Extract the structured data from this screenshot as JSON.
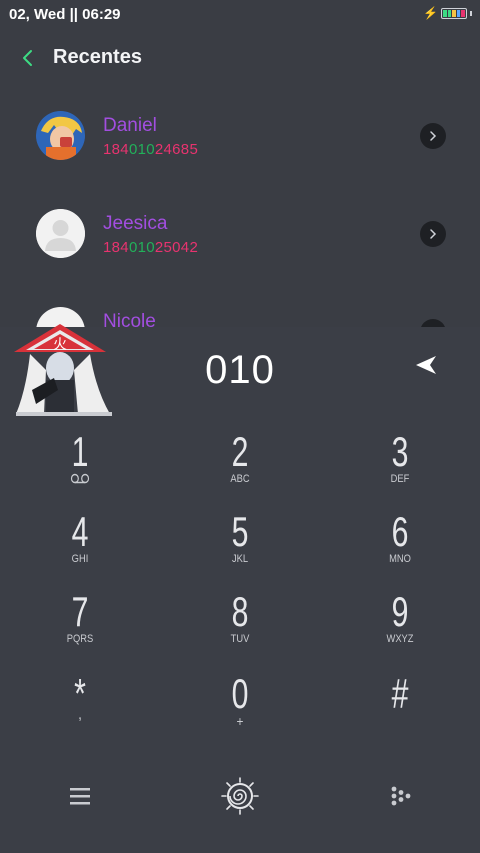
{
  "status": {
    "time": "02, Wed || 06:29"
  },
  "header": {
    "title": "Recentes"
  },
  "contacts": [
    {
      "name": "Daniel",
      "number_pre": "184",
      "number_hl": "010",
      "number_post": "24685"
    },
    {
      "name": "Jeesica",
      "number_pre": "184",
      "number_hl": "010",
      "number_post": "25042"
    },
    {
      "name": "Nicole"
    }
  ],
  "dialer": {
    "input": "010",
    "keys": [
      {
        "digit": "1",
        "sub": ""
      },
      {
        "digit": "2",
        "sub": "ABC"
      },
      {
        "digit": "3",
        "sub": "DEF"
      },
      {
        "digit": "4",
        "sub": "GHI"
      },
      {
        "digit": "5",
        "sub": "JKL"
      },
      {
        "digit": "6",
        "sub": "MNO"
      },
      {
        "digit": "7",
        "sub": "PQRS"
      },
      {
        "digit": "8",
        "sub": "TUV"
      },
      {
        "digit": "9",
        "sub": "WXYZ"
      },
      {
        "digit": "*",
        "sub": ","
      },
      {
        "digit": "0",
        "sub": "+"
      },
      {
        "digit": "#",
        "sub": ""
      }
    ]
  },
  "icons": {
    "back": "chevron-left-icon",
    "send": "send-arrow-icon",
    "voicemail": "voicemail-icon",
    "menu": "hamburger-icon",
    "call": "spiral-seal-icon",
    "dialpad_toggle": "dialpad-icon"
  },
  "colors": {
    "background": "#3a3d44",
    "name": "#a24ee0",
    "number": "#e8336f",
    "number_match": "#22b05a",
    "accent": "#3ddc84"
  }
}
